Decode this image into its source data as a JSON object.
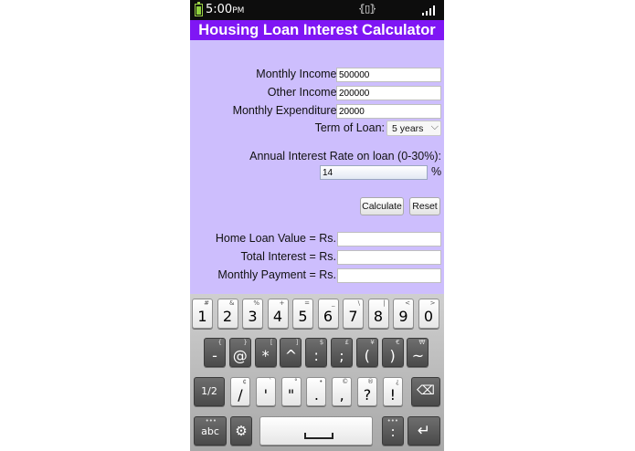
{
  "status_bar": {
    "time": "5:00",
    "ampm": "PM"
  },
  "app": {
    "title": "Housing Loan Interest Calculator"
  },
  "form": {
    "monthly_income_label": "Monthly Income:",
    "monthly_income_value": "500000",
    "other_income_label": "Other Income:",
    "other_income_value": "200000",
    "monthly_expenditure_label": "Monthly Expenditure:",
    "monthly_expenditure_value": "20000",
    "term_label": "Term of Loan:",
    "term_value": "5 years",
    "rate_label": "Annual Interest Rate on loan (0-30%):",
    "rate_value": "14",
    "rate_unit": "%",
    "calculate_label": "Calculate",
    "reset_label": "Reset"
  },
  "results": {
    "home_loan_label": "Home Loan Value = Rs.",
    "home_loan_value": "",
    "total_interest_label": "Total Interest = Rs.",
    "total_interest_value": "",
    "monthly_payment_label": "Monthly Payment = Rs.",
    "monthly_payment_value": ""
  },
  "keyboard": {
    "row1": [
      {
        "main": "1",
        "sub": "#"
      },
      {
        "main": "2",
        "sub": "&"
      },
      {
        "main": "3",
        "sub": "%"
      },
      {
        "main": "4",
        "sub": "+"
      },
      {
        "main": "5",
        "sub": "="
      },
      {
        "main": "6",
        "sub": "_"
      },
      {
        "main": "7",
        "sub": "\\"
      },
      {
        "main": "8",
        "sub": "|"
      },
      {
        "main": "9",
        "sub": "<"
      },
      {
        "main": "0",
        "sub": ">"
      }
    ],
    "row2": [
      {
        "main": "-",
        "sub": "{"
      },
      {
        "main": "@",
        "sub": "}"
      },
      {
        "main": "*",
        "sub": "["
      },
      {
        "main": "^",
        "sub": "]"
      },
      {
        "main": ":",
        "sub": "$"
      },
      {
        "main": ";",
        "sub": "£"
      },
      {
        "main": "(",
        "sub": "¥"
      },
      {
        "main": ")",
        "sub": "€"
      },
      {
        "main": "~",
        "sub": "₩"
      }
    ],
    "row3": [
      {
        "main": "/",
        "sub": "¢"
      },
      {
        "main": "'",
        "sub": "`"
      },
      {
        "main": "\"",
        "sub": "°"
      },
      {
        "main": ".",
        "sub": "•"
      },
      {
        "main": ",",
        "sub": "©"
      },
      {
        "main": "?",
        "sub": "®"
      },
      {
        "main": "!",
        "sub": "¿"
      }
    ],
    "page_label": "1/2",
    "abc_label": "abc",
    "abc_sub": "•••",
    "colon_label": ":",
    "colon_sub": "•••"
  }
}
